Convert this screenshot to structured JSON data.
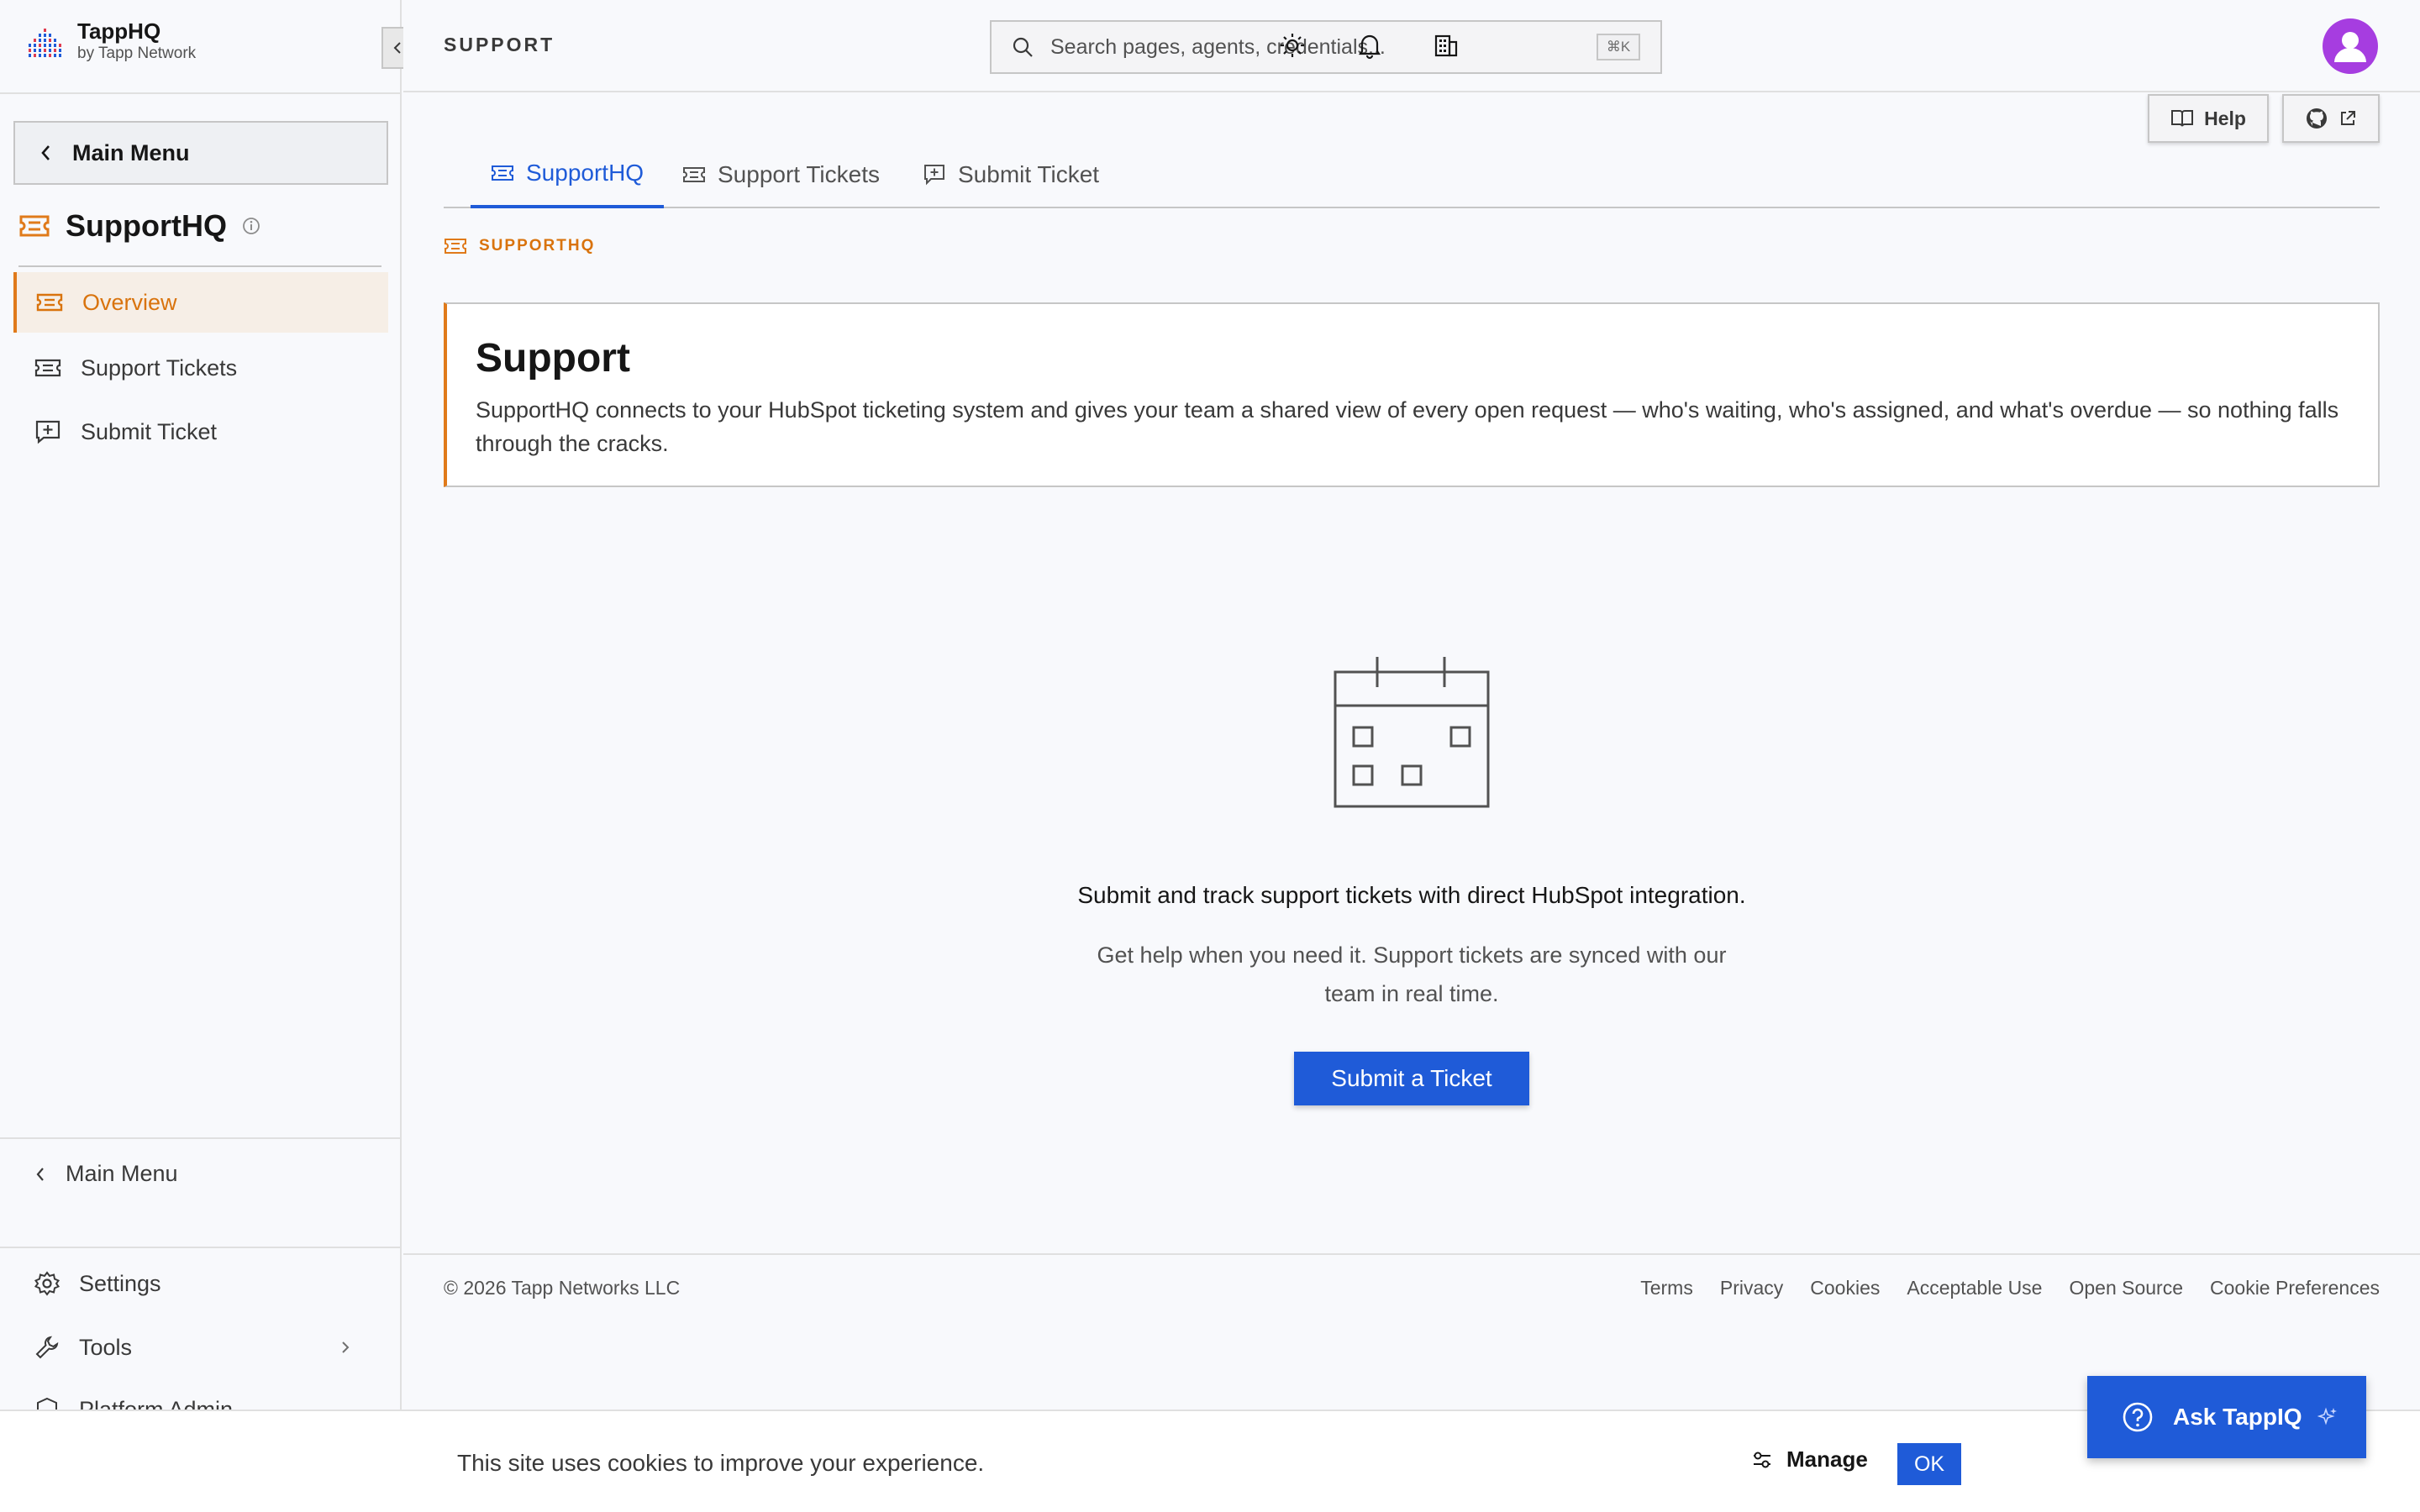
{
  "brand": {
    "name": "TappHQ",
    "sub": "by Tapp Network"
  },
  "sidebar": {
    "main_menu_label": "Main Menu",
    "module_title": "SupportHQ",
    "items": [
      {
        "label": "Overview",
        "icon": "ticket-icon",
        "active": true
      },
      {
        "label": "Support Tickets",
        "icon": "ticket-icon"
      },
      {
        "label": "Submit Ticket",
        "icon": "add-comment-icon"
      }
    ],
    "bottom": {
      "main_menu_label": "Main Menu",
      "settings_label": "Settings",
      "tools_label": "Tools",
      "platform_label": "Platform Admin"
    }
  },
  "header": {
    "title": "SUPPORT",
    "search_placeholder": "Search pages, agents, credentials...",
    "search_shortcut": "⌘K",
    "icons": [
      "sun-icon",
      "bell-icon",
      "building-icon",
      "avatar"
    ]
  },
  "toolbar": {
    "help_label": "Help"
  },
  "tabs": [
    {
      "label": "SupportHQ",
      "active": true
    },
    {
      "label": "Support Tickets"
    },
    {
      "label": "Submit Ticket"
    }
  ],
  "breadcrumb": "SUPPORTHQ",
  "intro": {
    "title": "Support",
    "body": "SupportHQ connects to your HubSpot ticketing system and gives your team a shared view of every open request — who's waiting, who's assigned, and what's overdue — so nothing falls through the cracks."
  },
  "empty_state": {
    "title": "Submit and track support tickets with direct HubSpot integration.",
    "description": "Get help when you need it. Support tickets are synced with our team in real time.",
    "cta_label": "Submit a Ticket"
  },
  "footer": {
    "copyright": "© 2026 Tapp Networks LLC",
    "links": [
      "Terms",
      "Privacy",
      "Cookies",
      "Acceptable Use",
      "Open Source",
      "Cookie Preferences"
    ]
  },
  "cookie_bar": {
    "text": "This site uses cookies to improve your experience.",
    "manage_label": "Manage",
    "ok_label": "OK"
  },
  "assistant": {
    "label": "Ask TappIQ"
  },
  "colors": {
    "accent": "#1f5bd8",
    "orange": "#e07a1a",
    "avatar": "#a63de0"
  }
}
